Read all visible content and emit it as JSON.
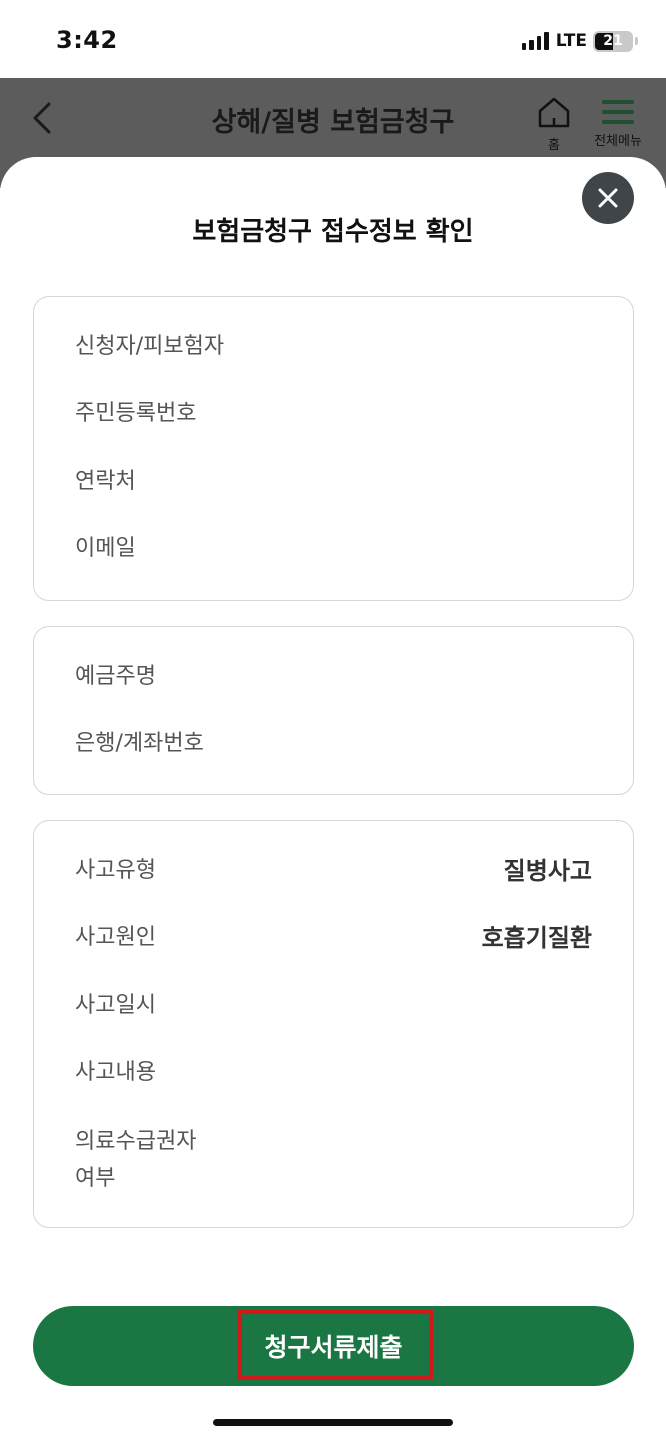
{
  "status_bar": {
    "time": "3:42",
    "network": "LTE",
    "battery": "21"
  },
  "header": {
    "title": "상해/질병 보험금청구",
    "home_label": "홈",
    "menu_label": "전체메뉴"
  },
  "sheet": {
    "title": "보험금청구 접수정보 확인",
    "applicant_card": [
      {
        "label": "신청자/피보험자",
        "value": ""
      },
      {
        "label": "주민등록번호",
        "value": ""
      },
      {
        "label": "연락처",
        "value": ""
      },
      {
        "label": "이메일",
        "value": ""
      }
    ],
    "account_card": [
      {
        "label": "예금주명",
        "value": ""
      },
      {
        "label": "은행/계좌번호",
        "value": ""
      }
    ],
    "accident_card": [
      {
        "label": "사고유형",
        "value": "질병사고"
      },
      {
        "label": "사고원인",
        "value": "호흡기질환"
      },
      {
        "label": "사고일시",
        "value": ""
      },
      {
        "label": "사고내용",
        "value": ""
      },
      {
        "label": "의료수급권자\n여부",
        "value": ""
      }
    ],
    "submit_label": "청구서류제출"
  },
  "colors": {
    "accent": "#1a7743",
    "highlight": "#d21919",
    "overlay": "#5c5c5c"
  }
}
